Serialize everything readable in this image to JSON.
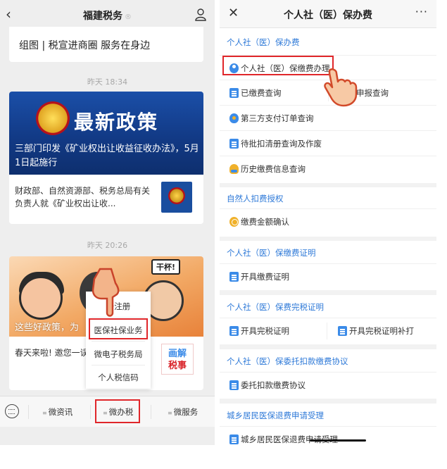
{
  "left_phone": {
    "back_glyph": "‹",
    "title": "福建税务",
    "title_mark": "®",
    "intro_text": "组图 | 税宣进商圈 服务在身边",
    "time1": "昨天 18:34",
    "article1": {
      "banner_title": "最新政策",
      "banner_caption": "三部门印发《矿业权出让收益征收办法》，5月1日起施行",
      "summary": "财政部、自然资源部、税务总局有关负责人就《矿业权出让收..."
    },
    "time2": "昨天 20:26",
    "article2": {
      "bubble": "干杯!",
      "banner_caption": "这些好政策，为",
      "summary": "春天来啦! 邀您一误",
      "thumb_line1": "画解",
      "thumb_line2": "税事"
    },
    "popup": {
      "items": [
        "务注册",
        "医保社保业务",
        "微电子税务局",
        "个人税信码"
      ]
    },
    "tabbar": {
      "tab1": "微资讯",
      "tab2": "微办税",
      "tab3": "微服务",
      "dots": "≡"
    }
  },
  "right_phone": {
    "close_glyph": "✕",
    "title": "个人社（医）保办费",
    "more_glyph": "···",
    "sections": [
      {
        "title": "个人社（医）保办费",
        "items": [
          "个人社（医）保缴费办理",
          "已缴费查询",
          "申报查询",
          "第三方支付订单查询",
          "待批扣清册查询及作废",
          "历史缴费信息查询"
        ]
      },
      {
        "title": "自然人扣费授权",
        "items": [
          "缴费金额确认"
        ]
      },
      {
        "title": "个人社（医）保缴费证明",
        "items": [
          "开具缴费证明"
        ]
      },
      {
        "title": "个人社（医）保费完税证明",
        "items": [
          "开具完税证明",
          "开具完税证明补打"
        ]
      },
      {
        "title": "个人社（医）保委托扣款缴费协议",
        "items": [
          "委托扣款缴费协议"
        ]
      },
      {
        "title": "城乡居民医保退费申请受理",
        "items": [
          "城乡居民医保退费申请受理"
        ]
      }
    ]
  },
  "colors": {
    "highlight_red": "#e0262a",
    "section_blue": "#2f7ad8",
    "icon_blue": "#3b8be8",
    "icon_gold": "#f0b12a",
    "banner_blue": "#123a86"
  }
}
